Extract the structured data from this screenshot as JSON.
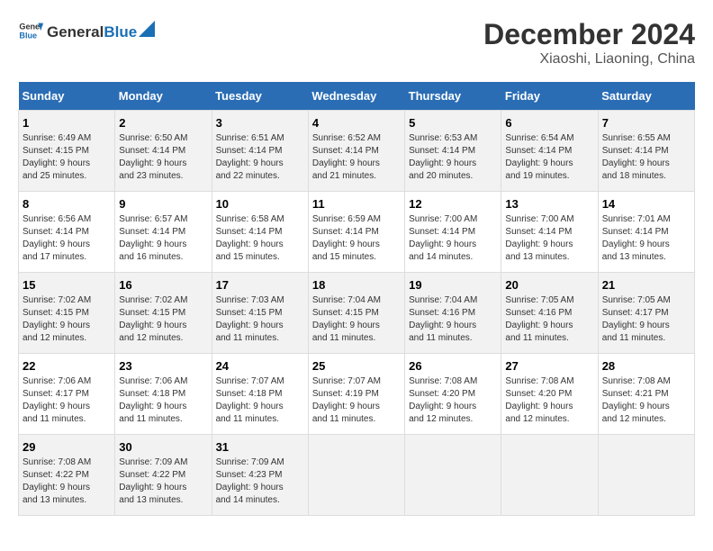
{
  "logo": {
    "text_general": "General",
    "text_blue": "Blue"
  },
  "title": "December 2024",
  "subtitle": "Xiaoshi, Liaoning, China",
  "weekdays": [
    "Sunday",
    "Monday",
    "Tuesday",
    "Wednesday",
    "Thursday",
    "Friday",
    "Saturday"
  ],
  "weeks": [
    [
      {
        "day": "1",
        "info": "Sunrise: 6:49 AM\nSunset: 4:15 PM\nDaylight: 9 hours\nand 25 minutes."
      },
      {
        "day": "2",
        "info": "Sunrise: 6:50 AM\nSunset: 4:14 PM\nDaylight: 9 hours\nand 23 minutes."
      },
      {
        "day": "3",
        "info": "Sunrise: 6:51 AM\nSunset: 4:14 PM\nDaylight: 9 hours\nand 22 minutes."
      },
      {
        "day": "4",
        "info": "Sunrise: 6:52 AM\nSunset: 4:14 PM\nDaylight: 9 hours\nand 21 minutes."
      },
      {
        "day": "5",
        "info": "Sunrise: 6:53 AM\nSunset: 4:14 PM\nDaylight: 9 hours\nand 20 minutes."
      },
      {
        "day": "6",
        "info": "Sunrise: 6:54 AM\nSunset: 4:14 PM\nDaylight: 9 hours\nand 19 minutes."
      },
      {
        "day": "7",
        "info": "Sunrise: 6:55 AM\nSunset: 4:14 PM\nDaylight: 9 hours\nand 18 minutes."
      }
    ],
    [
      {
        "day": "8",
        "info": "Sunrise: 6:56 AM\nSunset: 4:14 PM\nDaylight: 9 hours\nand 17 minutes."
      },
      {
        "day": "9",
        "info": "Sunrise: 6:57 AM\nSunset: 4:14 PM\nDaylight: 9 hours\nand 16 minutes."
      },
      {
        "day": "10",
        "info": "Sunrise: 6:58 AM\nSunset: 4:14 PM\nDaylight: 9 hours\nand 15 minutes."
      },
      {
        "day": "11",
        "info": "Sunrise: 6:59 AM\nSunset: 4:14 PM\nDaylight: 9 hours\nand 15 minutes."
      },
      {
        "day": "12",
        "info": "Sunrise: 7:00 AM\nSunset: 4:14 PM\nDaylight: 9 hours\nand 14 minutes."
      },
      {
        "day": "13",
        "info": "Sunrise: 7:00 AM\nSunset: 4:14 PM\nDaylight: 9 hours\nand 13 minutes."
      },
      {
        "day": "14",
        "info": "Sunrise: 7:01 AM\nSunset: 4:14 PM\nDaylight: 9 hours\nand 13 minutes."
      }
    ],
    [
      {
        "day": "15",
        "info": "Sunrise: 7:02 AM\nSunset: 4:15 PM\nDaylight: 9 hours\nand 12 minutes."
      },
      {
        "day": "16",
        "info": "Sunrise: 7:02 AM\nSunset: 4:15 PM\nDaylight: 9 hours\nand 12 minutes."
      },
      {
        "day": "17",
        "info": "Sunrise: 7:03 AM\nSunset: 4:15 PM\nDaylight: 9 hours\nand 11 minutes."
      },
      {
        "day": "18",
        "info": "Sunrise: 7:04 AM\nSunset: 4:15 PM\nDaylight: 9 hours\nand 11 minutes."
      },
      {
        "day": "19",
        "info": "Sunrise: 7:04 AM\nSunset: 4:16 PM\nDaylight: 9 hours\nand 11 minutes."
      },
      {
        "day": "20",
        "info": "Sunrise: 7:05 AM\nSunset: 4:16 PM\nDaylight: 9 hours\nand 11 minutes."
      },
      {
        "day": "21",
        "info": "Sunrise: 7:05 AM\nSunset: 4:17 PM\nDaylight: 9 hours\nand 11 minutes."
      }
    ],
    [
      {
        "day": "22",
        "info": "Sunrise: 7:06 AM\nSunset: 4:17 PM\nDaylight: 9 hours\nand 11 minutes."
      },
      {
        "day": "23",
        "info": "Sunrise: 7:06 AM\nSunset: 4:18 PM\nDaylight: 9 hours\nand 11 minutes."
      },
      {
        "day": "24",
        "info": "Sunrise: 7:07 AM\nSunset: 4:18 PM\nDaylight: 9 hours\nand 11 minutes."
      },
      {
        "day": "25",
        "info": "Sunrise: 7:07 AM\nSunset: 4:19 PM\nDaylight: 9 hours\nand 11 minutes."
      },
      {
        "day": "26",
        "info": "Sunrise: 7:08 AM\nSunset: 4:20 PM\nDaylight: 9 hours\nand 12 minutes."
      },
      {
        "day": "27",
        "info": "Sunrise: 7:08 AM\nSunset: 4:20 PM\nDaylight: 9 hours\nand 12 minutes."
      },
      {
        "day": "28",
        "info": "Sunrise: 7:08 AM\nSunset: 4:21 PM\nDaylight: 9 hours\nand 12 minutes."
      }
    ],
    [
      {
        "day": "29",
        "info": "Sunrise: 7:08 AM\nSunset: 4:22 PM\nDaylight: 9 hours\nand 13 minutes."
      },
      {
        "day": "30",
        "info": "Sunrise: 7:09 AM\nSunset: 4:22 PM\nDaylight: 9 hours\nand 13 minutes."
      },
      {
        "day": "31",
        "info": "Sunrise: 7:09 AM\nSunset: 4:23 PM\nDaylight: 9 hours\nand 14 minutes."
      },
      {
        "day": "",
        "info": ""
      },
      {
        "day": "",
        "info": ""
      },
      {
        "day": "",
        "info": ""
      },
      {
        "day": "",
        "info": ""
      }
    ]
  ]
}
